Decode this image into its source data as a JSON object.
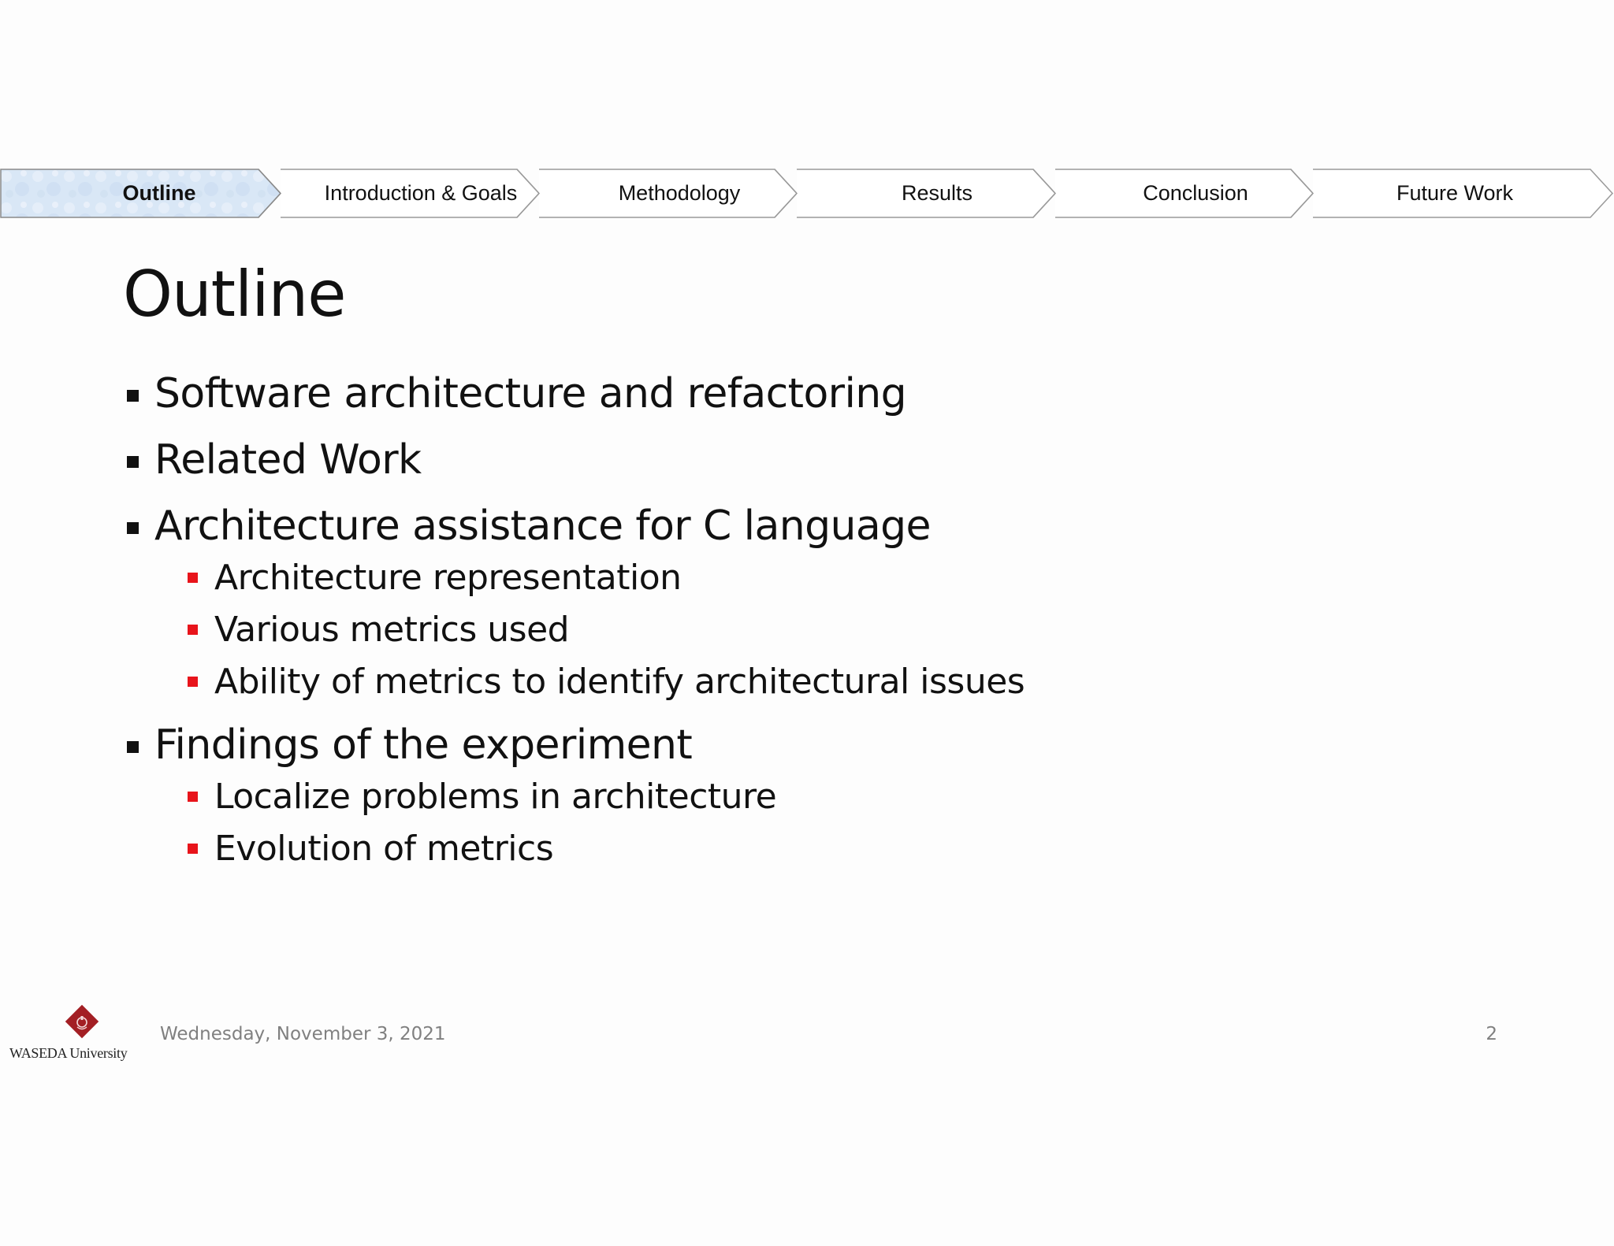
{
  "nav": {
    "steps": [
      {
        "label": "Outline",
        "active": true
      },
      {
        "label": "Introduction & Goals",
        "active": false
      },
      {
        "label": "Methodology",
        "active": false
      },
      {
        "label": "Results",
        "active": false
      },
      {
        "label": "Conclusion",
        "active": false
      },
      {
        "label": "Future Work",
        "active": false
      }
    ]
  },
  "slide": {
    "title": "Outline",
    "bullets": [
      {
        "text": "Software architecture and refactoring"
      },
      {
        "text": "Related Work"
      },
      {
        "text": "Architecture assistance for C language",
        "subitems": [
          "Architecture representation",
          "Various metrics used",
          "Ability of metrics to identify architectural issues"
        ]
      },
      {
        "text": "Findings of the experiment",
        "subitems": [
          "Localize problems in architecture",
          "Evolution of metrics"
        ]
      }
    ]
  },
  "footer": {
    "logo_text": "WASEDA University",
    "date": "Wednesday, November 3, 2021",
    "page_number": "2"
  },
  "colors": {
    "active_step_fill": "#dce9f7",
    "chevron_stroke": "#9a9a9a",
    "sub_bullet": "#e8141b",
    "logo_red": "#a31f24",
    "footer_text": "#808080"
  }
}
